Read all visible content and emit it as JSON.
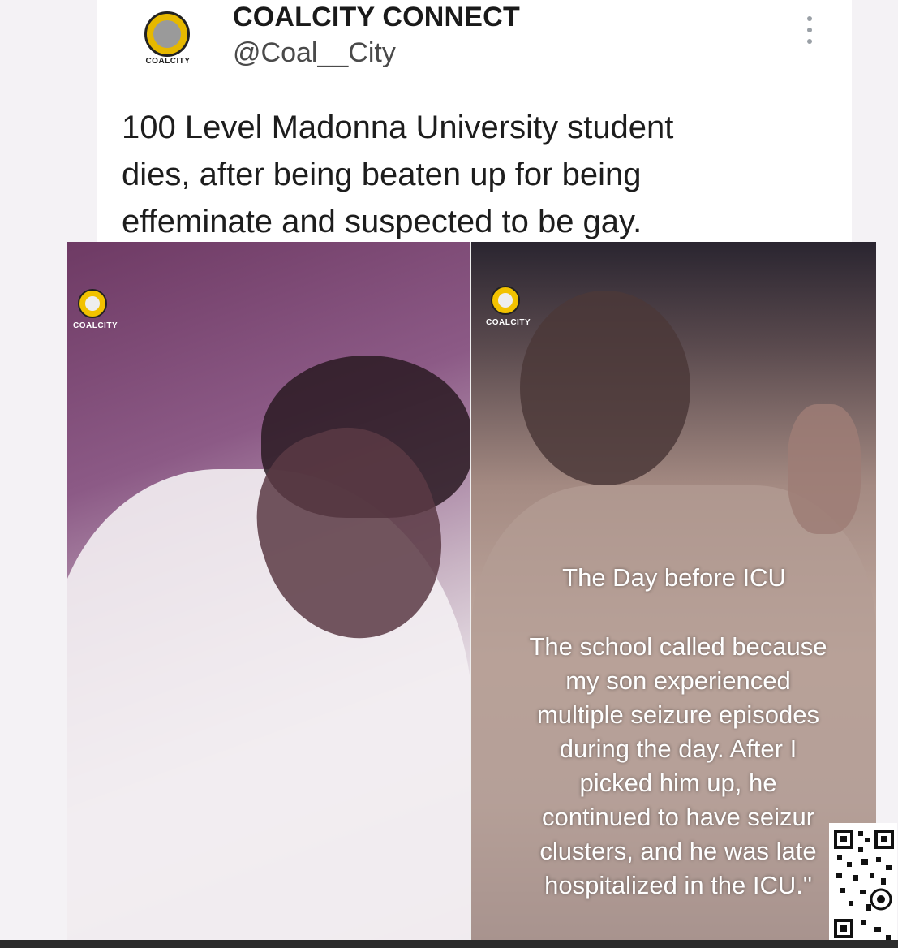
{
  "tweet": {
    "display_name": "COALCITY CONNECT",
    "handle": "@Coal__City",
    "avatar_wordmark": "COALCITY",
    "text_lines": [
      "100 Level Madonna University student",
      "dies, after being beaten up for being",
      "effeminate and suspected to be gay."
    ]
  },
  "images": {
    "left": {
      "watermark": "COALCITY"
    },
    "right": {
      "watermark": "COALCITY",
      "caption_title": "The Day before ICU",
      "caption_lines": [
        "The school called because",
        "my son experienced",
        "multiple seizure episodes",
        "during the day. After I",
        "picked him up, he",
        "continued to have seizur",
        "clusters, and he was late",
        "hospitalized in the ICU.\""
      ]
    }
  },
  "colors": {
    "brand_yellow": "#f2c200",
    "left_tint": "#8c5a86"
  },
  "icons": {
    "more": "more-vertical-icon",
    "qr": "qr-code-icon"
  }
}
